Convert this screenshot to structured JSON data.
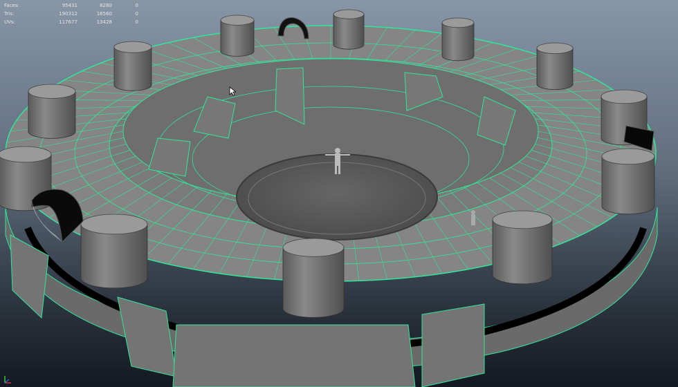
{
  "hud": {
    "rows": [
      {
        "label": "Faces:",
        "values": [
          "95431",
          "8280",
          "0"
        ]
      },
      {
        "label": "Tris:",
        "values": [
          "190312",
          "16560",
          "0"
        ]
      },
      {
        "label": "UVs:",
        "values": [
          "117677",
          "13428",
          "0"
        ]
      }
    ]
  },
  "colors": {
    "wire": "#2ee89a",
    "mesh": "#7e7e7e",
    "mesh_dark": "#474747",
    "pillar_top": "#9a9a9a",
    "pillar_side": "#6f6f6f",
    "center_disc": "#5a5a5a"
  },
  "icons": {
    "cursor": "arrow-cursor-icon",
    "axis": "xyz-axis-gizmo-icon"
  }
}
